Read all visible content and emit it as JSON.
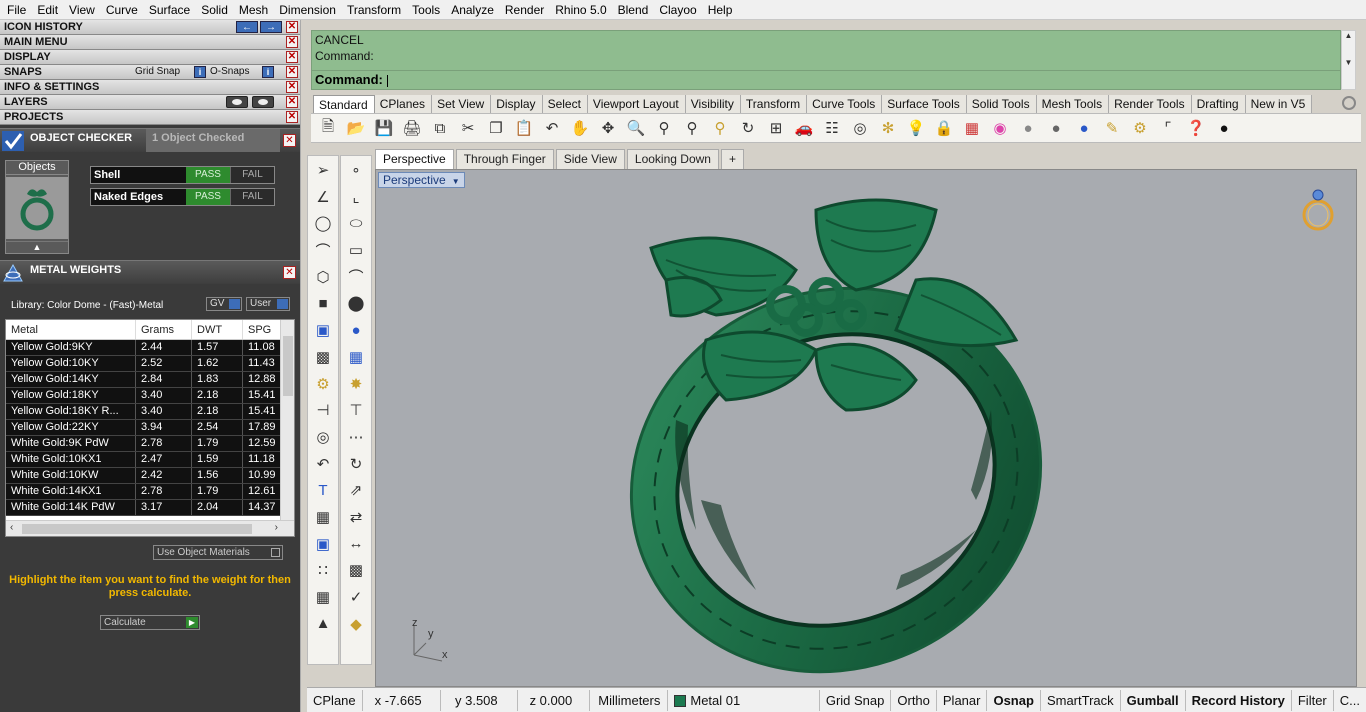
{
  "menu": [
    "File",
    "Edit",
    "View",
    "Curve",
    "Surface",
    "Solid",
    "Mesh",
    "Dimension",
    "Transform",
    "Tools",
    "Analyze",
    "Render",
    "Rhino 5.0",
    "Blend",
    "Clayoo",
    "Help"
  ],
  "left_panel": {
    "rows": {
      "icon_history": "ICON HISTORY",
      "main_menu": "MAIN MENU",
      "display": "DISPLAY",
      "snaps": "SNAPS",
      "grid_snap": "Grid Snap",
      "o_snaps": "O-Snaps",
      "info_settings": "INFO & SETTINGS",
      "layers": "LAYERS",
      "projects": "PROJECTS"
    },
    "object_checker": {
      "title": "OBJECT CHECKER",
      "status": "1 Object Checked",
      "objects_tab": "Objects",
      "checks": [
        {
          "name": "Shell",
          "pass": "PASS",
          "fail": "FAIL"
        },
        {
          "name": "Naked Edges",
          "pass": "PASS",
          "fail": "FAIL"
        }
      ]
    },
    "metal_weights": {
      "title": "METAL WEIGHTS",
      "library": "Library: Color Dome - (Fast)-Metal",
      "gv": "GV",
      "user": "User",
      "headers": [
        "Metal",
        "Grams",
        "DWT",
        "SPG"
      ],
      "rows": [
        [
          "Yellow Gold:9KY",
          "2.44",
          "1.57",
          "11.08"
        ],
        [
          "Yellow Gold:10KY",
          "2.52",
          "1.62",
          "11.43"
        ],
        [
          "Yellow Gold:14KY",
          "2.84",
          "1.83",
          "12.88"
        ],
        [
          "Yellow Gold:18KY",
          "3.40",
          "2.18",
          "15.41"
        ],
        [
          "Yellow Gold:18KY R...",
          "3.40",
          "2.18",
          "15.41"
        ],
        [
          "Yellow Gold:22KY",
          "3.94",
          "2.54",
          "17.89"
        ],
        [
          "White Gold:9K PdW",
          "2.78",
          "1.79",
          "12.59"
        ],
        [
          "White Gold:10KX1",
          "2.47",
          "1.59",
          "11.18"
        ],
        [
          "White Gold:10KW",
          "2.42",
          "1.56",
          "10.99"
        ],
        [
          "White Gold:14KX1",
          "2.78",
          "1.79",
          "12.61"
        ],
        [
          "White Gold:14K PdW",
          "3.17",
          "2.04",
          "14.37"
        ]
      ],
      "use_object_materials": "Use Object Materials",
      "hint": "Highlight the item you want to find the weight for then press calculate.",
      "calculate": "Calculate"
    }
  },
  "command": {
    "line1": "CANCEL",
    "line2": "Command:",
    "prompt": "Command:"
  },
  "toolbar_tabs": [
    "Standard",
    "CPlanes",
    "Set View",
    "Display",
    "Select",
    "Viewport Layout",
    "Visibility",
    "Transform",
    "Curve Tools",
    "Surface Tools",
    "Solid Tools",
    "Mesh Tools",
    "Render Tools",
    "Drafting",
    "New in V5"
  ],
  "viewport_tabs": [
    "Perspective",
    "Through Finger",
    "Side View",
    "Looking Down",
    "+"
  ],
  "viewport": {
    "label": "Perspective",
    "axes": {
      "x": "x",
      "y": "y",
      "z": "z"
    }
  },
  "status": {
    "cplane": "CPlane",
    "x": "x -7.665",
    "y": "y 3.508",
    "z": "z 0.000",
    "units": "Millimeters",
    "layer": "Metal 01",
    "layer_color": "#1c7a50",
    "grid_snap": "Grid Snap",
    "ortho": "Ortho",
    "planar": "Planar",
    "osnap": "Osnap",
    "smarttrack": "SmartTrack",
    "gumball": "Gumball",
    "record_history": "Record History",
    "filter": "Filter",
    "more": "C..."
  },
  "colors": {
    "ring": "#1e6e4a",
    "command_bg": "#8fbc8f",
    "viewport_bg": "#a8abb0"
  }
}
